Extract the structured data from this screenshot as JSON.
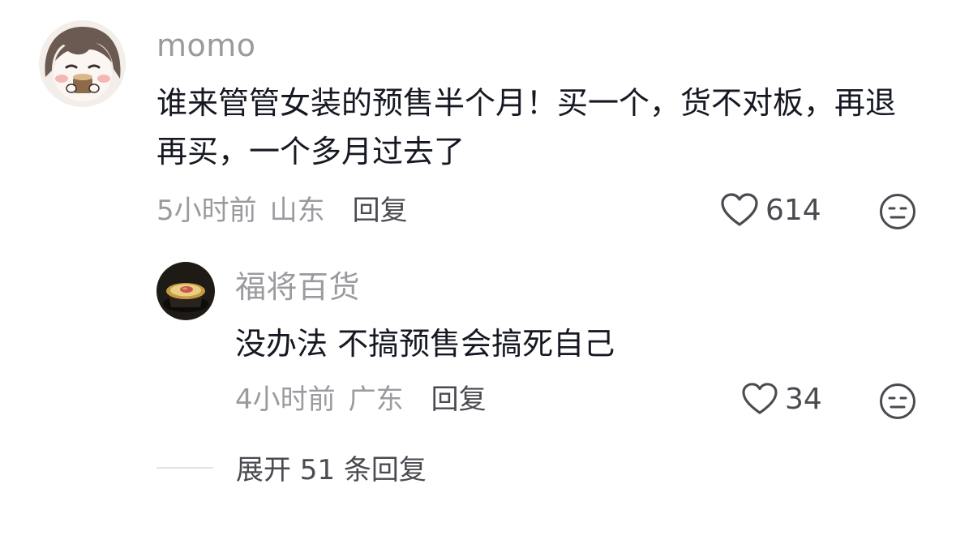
{
  "comment": {
    "username": "momo",
    "text": "谁来管管女装的预售半个月！买一个，货不对板，再退再买，一个多月过去了",
    "time": "5小时前",
    "location": "山东",
    "reply_label": "回复",
    "likes": "614",
    "avatar_icon": "cartoon-avatar-icon",
    "like_icon": "heart-outline-icon",
    "dislike_icon": "meh-face-icon"
  },
  "reply": {
    "username": "福将百货",
    "text": "没办法 不搞预售会搞死自己",
    "time": "4小时前",
    "location": "广东",
    "reply_label": "回复",
    "likes": "34",
    "avatar_icon": "dessert-photo-avatar-icon",
    "like_icon": "heart-outline-icon",
    "dislike_icon": "meh-face-icon"
  },
  "expand": {
    "label": "展开 51 条回复"
  },
  "colors": {
    "username": "#9a9a9f",
    "text": "#161823",
    "meta": "#9a9a9f",
    "action": "#4a4a50",
    "divider": "#e3e3e6"
  }
}
